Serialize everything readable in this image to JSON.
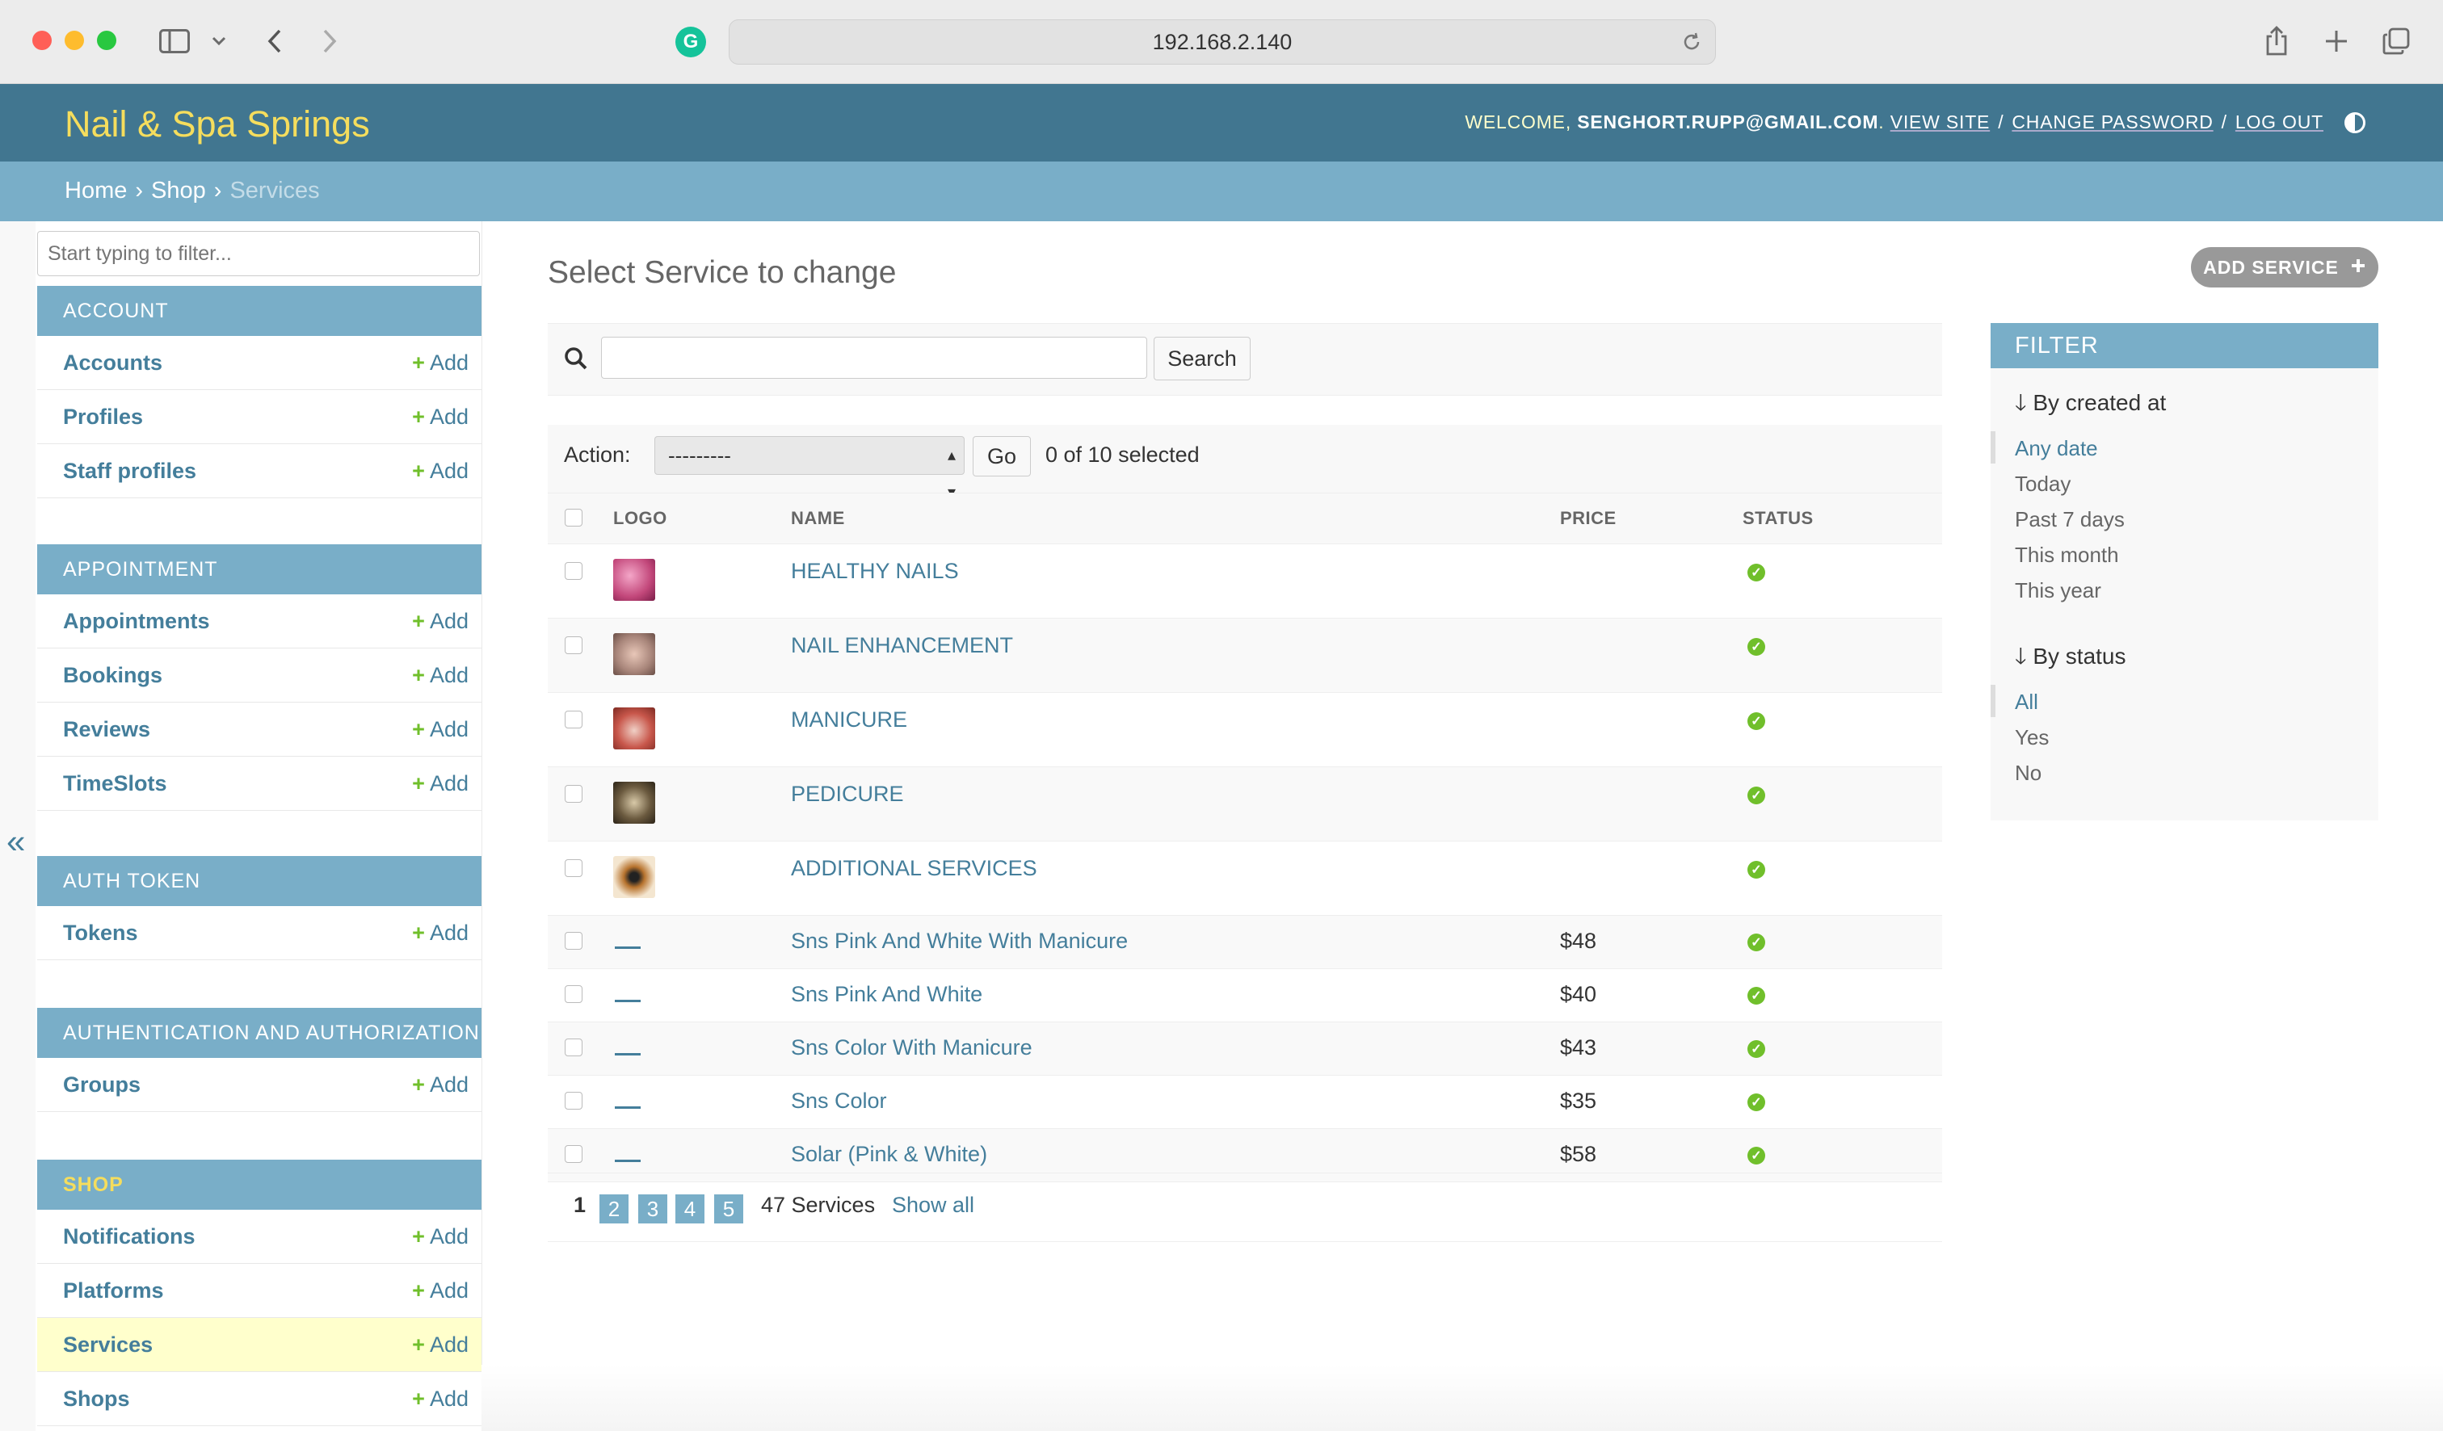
{
  "browser": {
    "url": "192.168.2.140"
  },
  "header": {
    "site_name": "Nail & Spa Springs",
    "welcome": "WELCOME,",
    "user": "SENGHORT.RUPP@GMAIL.COM",
    "period": ".",
    "view_site": "VIEW SITE",
    "change_password": "CHANGE PASSWORD",
    "log_out": "LOG OUT",
    "sep": "/"
  },
  "breadcrumbs": {
    "home": "Home",
    "shop": "Shop",
    "current": "Services",
    "sep": "›"
  },
  "sidebar": {
    "filter_placeholder": "Start typing to filter...",
    "collapse_glyph": "«",
    "add_label": "Add",
    "add_glyph": "+",
    "modules": [
      {
        "caption": "ACCOUNT",
        "models": [
          "Accounts",
          "Profiles",
          "Staff profiles"
        ]
      },
      {
        "caption": "APPOINTMENT",
        "models": [
          "Appointments",
          "Bookings",
          "Reviews",
          "TimeSlots"
        ]
      },
      {
        "caption": "AUTH TOKEN",
        "models": [
          "Tokens"
        ]
      },
      {
        "caption": "AUTHENTICATION AND AUTHORIZATION",
        "models": [
          "Groups"
        ]
      },
      {
        "caption": "SHOP",
        "models": [
          "Notifications",
          "Platforms",
          "Services",
          "Shops"
        ]
      }
    ]
  },
  "main": {
    "title": "Select Service to change",
    "add_button": "ADD SERVICE",
    "search_button": "Search",
    "action_label": "Action:",
    "action_value": "---------",
    "go_button": "Go",
    "selected_count": "0 of 10 selected",
    "columns": [
      "LOGO",
      "NAME",
      "PRICE",
      "STATUS"
    ],
    "rows": [
      {
        "name": "HEALTHY NAILS",
        "price": "",
        "logo_color": "#c2477a"
      },
      {
        "name": "NAIL ENHANCEMENT",
        "price": "",
        "logo_color": "#a8857a"
      },
      {
        "name": "MANICURE",
        "price": "",
        "logo_color": "#c8574b"
      },
      {
        "name": "PEDICURE",
        "price": "",
        "logo_color": "#6b5a3f"
      },
      {
        "name": "ADDITIONAL SERVICES",
        "price": "",
        "logo_color": "#b8742f"
      },
      {
        "name": "Sns Pink And White With Manicure",
        "price": "$48"
      },
      {
        "name": "Sns Pink And White",
        "price": "$40"
      },
      {
        "name": "Sns Color With Manicure",
        "price": "$43"
      },
      {
        "name": "Sns Color",
        "price": "$35"
      },
      {
        "name": "Solar (Pink & White)",
        "price": "$58"
      }
    ],
    "pagination": {
      "current": "1",
      "pages": [
        "2",
        "3",
        "4",
        "5"
      ],
      "total": "47 Services",
      "show_all": "Show all"
    }
  },
  "filter": {
    "title": "FILTER",
    "created_heading": "By created at",
    "created_options": [
      "Any date",
      "Today",
      "Past 7 days",
      "This month",
      "This year"
    ],
    "status_heading": "By status",
    "status_options": [
      "All",
      "Yes",
      "No"
    ]
  },
  "colors": {
    "header": "#417690",
    "breadcrumbs": "#79aec8",
    "site_name": "#f5dd5d",
    "link": "#447e9b",
    "status_ok": "#70bf2b"
  }
}
